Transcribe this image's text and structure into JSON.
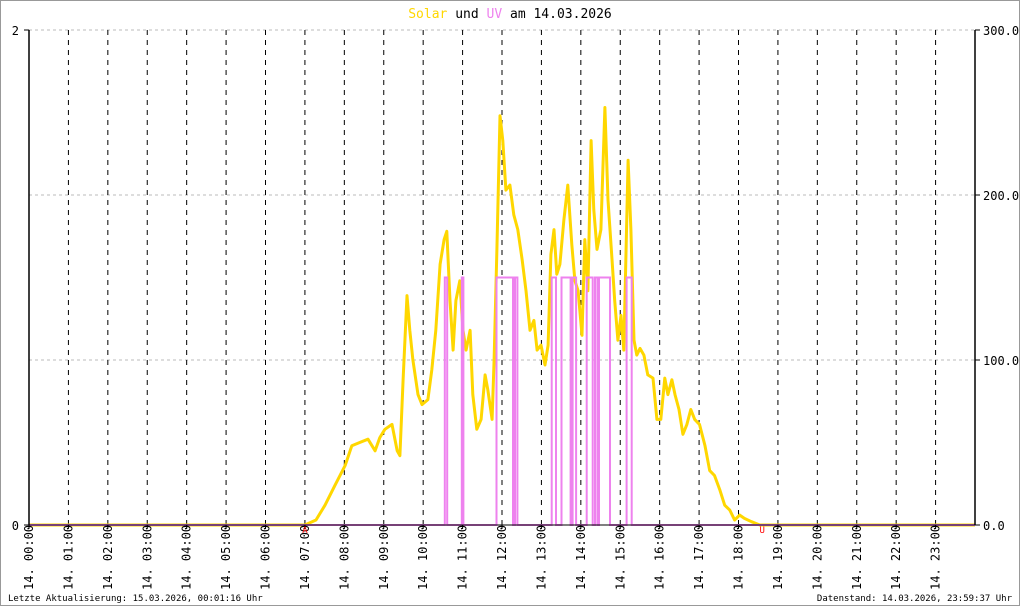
{
  "chart_data": {
    "type": "line",
    "title": {
      "part1": "Solar",
      "part2": " und ",
      "part3": "UV",
      "part4": " am 14.03.2026"
    },
    "x_range_hours": [
      0,
      24
    ],
    "x_tick_labels": [
      "14. 00:00",
      "14. 01:00",
      "14. 02:00",
      "14. 03:00",
      "14. 04:00",
      "14. 05:00",
      "14. 06:00",
      "14. 07:00",
      "14. 08:00",
      "14. 09:00",
      "14. 10:00",
      "14. 11:00",
      "14. 12:00",
      "14. 13:00",
      "14. 14:00",
      "14. 15:00",
      "14. 16:00",
      "14. 17:00",
      "14. 18:00",
      "14. 19:00",
      "14. 20:00",
      "14. 21:00",
      "14. 22:00",
      "14. 23:00"
    ],
    "left_axis": {
      "series": "UV",
      "ylim": [
        0,
        2
      ],
      "tick_labels": [
        "0",
        "2"
      ],
      "ticks": [
        0,
        2
      ]
    },
    "right_axis": {
      "series": "Solar",
      "ylim": [
        0,
        300
      ],
      "tick_labels": [
        "0.0",
        "100.0",
        "200.0",
        "300.0"
      ],
      "ticks": [
        0,
        100,
        200,
        300
      ]
    },
    "grid": true,
    "markers": [
      {
        "label": "A",
        "hour": 7.0,
        "meaning": "sunrise"
      },
      {
        "label": "U",
        "hour": 18.6,
        "meaning": "sunset"
      }
    ],
    "colors": {
      "solar": "#ffd700",
      "uv": "#ee82ee",
      "marker": "#ff0000",
      "title_text": "#000000"
    },
    "series": [
      {
        "name": "Solar",
        "axis": "right",
        "points": [
          [
            0,
            0
          ],
          [
            7.0,
            0
          ],
          [
            7.28,
            3
          ],
          [
            7.51,
            12
          ],
          [
            7.76,
            24
          ],
          [
            8.02,
            36
          ],
          [
            8.19,
            48
          ],
          [
            8.39,
            50
          ],
          [
            8.6,
            52
          ],
          [
            8.78,
            45
          ],
          [
            8.9,
            53
          ],
          [
            9.03,
            58
          ],
          [
            9.21,
            61
          ],
          [
            9.34,
            45
          ],
          [
            9.41,
            42
          ],
          [
            9.49,
            88
          ],
          [
            9.59,
            139
          ],
          [
            9.66,
            118
          ],
          [
            9.74,
            100
          ],
          [
            9.87,
            79
          ],
          [
            9.97,
            73
          ],
          [
            10.12,
            76
          ],
          [
            10.22,
            94
          ],
          [
            10.32,
            118
          ],
          [
            10.43,
            158
          ],
          [
            10.53,
            173
          ],
          [
            10.6,
            178
          ],
          [
            10.68,
            136
          ],
          [
            10.76,
            106
          ],
          [
            10.83,
            136
          ],
          [
            10.93,
            148
          ],
          [
            11.01,
            118
          ],
          [
            11.09,
            106
          ],
          [
            11.19,
            118
          ],
          [
            11.26,
            79
          ],
          [
            11.36,
            58
          ],
          [
            11.47,
            64
          ],
          [
            11.57,
            91
          ],
          [
            11.64,
            82
          ],
          [
            11.75,
            64
          ],
          [
            11.8,
            100
          ],
          [
            11.87,
            167
          ],
          [
            11.95,
            248
          ],
          [
            12.02,
            233
          ],
          [
            12.1,
            203
          ],
          [
            12.2,
            206
          ],
          [
            12.3,
            188
          ],
          [
            12.4,
            179
          ],
          [
            12.51,
            161
          ],
          [
            12.61,
            142
          ],
          [
            12.71,
            118
          ],
          [
            12.81,
            124
          ],
          [
            12.89,
            106
          ],
          [
            12.99,
            109
          ],
          [
            13.09,
            97
          ],
          [
            13.17,
            109
          ],
          [
            13.24,
            164
          ],
          [
            13.32,
            179
          ],
          [
            13.39,
            152
          ],
          [
            13.47,
            158
          ],
          [
            13.57,
            185
          ],
          [
            13.67,
            206
          ],
          [
            13.77,
            170
          ],
          [
            13.85,
            148
          ],
          [
            13.93,
            142
          ],
          [
            14.03,
            115
          ],
          [
            14.1,
            173
          ],
          [
            14.18,
            142
          ],
          [
            14.26,
            233
          ],
          [
            14.33,
            191
          ],
          [
            14.41,
            167
          ],
          [
            14.51,
            179
          ],
          [
            14.61,
            253
          ],
          [
            14.69,
            197
          ],
          [
            14.79,
            161
          ],
          [
            14.86,
            136
          ],
          [
            14.94,
            112
          ],
          [
            15.02,
            127
          ],
          [
            15.09,
            106
          ],
          [
            15.2,
            221
          ],
          [
            15.27,
            179
          ],
          [
            15.35,
            112
          ],
          [
            15.42,
            103
          ],
          [
            15.5,
            107
          ],
          [
            15.6,
            103
          ],
          [
            15.7,
            91
          ],
          [
            15.83,
            89
          ],
          [
            15.93,
            64
          ],
          [
            16.03,
            64
          ],
          [
            16.13,
            89
          ],
          [
            16.21,
            79
          ],
          [
            16.31,
            88
          ],
          [
            16.39,
            79
          ],
          [
            16.49,
            70
          ],
          [
            16.59,
            55
          ],
          [
            16.69,
            61
          ],
          [
            16.79,
            70
          ],
          [
            16.89,
            64
          ],
          [
            17.01,
            61
          ],
          [
            17.15,
            48
          ],
          [
            17.27,
            33
          ],
          [
            17.39,
            30
          ],
          [
            17.53,
            21
          ],
          [
            17.65,
            12
          ],
          [
            17.78,
            9
          ],
          [
            17.9,
            3
          ],
          [
            18.03,
            6
          ],
          [
            18.15,
            4
          ],
          [
            18.33,
            2
          ],
          [
            18.54,
            0
          ],
          [
            24,
            0
          ]
        ]
      },
      {
        "name": "UV",
        "axis": "left",
        "segments_at_value": [
          {
            "start": 10.55,
            "end": 10.61,
            "value": 1
          },
          {
            "start": 10.98,
            "end": 11.02,
            "value": 1
          },
          {
            "start": 11.86,
            "end": 12.28,
            "value": 1
          },
          {
            "start": 12.33,
            "end": 12.39,
            "value": 1
          },
          {
            "start": 13.26,
            "end": 13.37,
            "value": 1
          },
          {
            "start": 13.51,
            "end": 13.74,
            "value": 1
          },
          {
            "start": 13.79,
            "end": 13.88,
            "value": 1
          },
          {
            "start": 14.15,
            "end": 14.3,
            "value": 1
          },
          {
            "start": 14.36,
            "end": 14.42,
            "value": 1
          },
          {
            "start": 14.46,
            "end": 14.74,
            "value": 1
          },
          {
            "start": 15.16,
            "end": 15.29,
            "value": 1
          }
        ]
      }
    ]
  },
  "footer": {
    "left": "Letzte Aktualisierung: 15.03.2026, 00:01:16 Uhr",
    "right": "Datenstand: 14.03.2026, 23:59:37 Uhr"
  }
}
